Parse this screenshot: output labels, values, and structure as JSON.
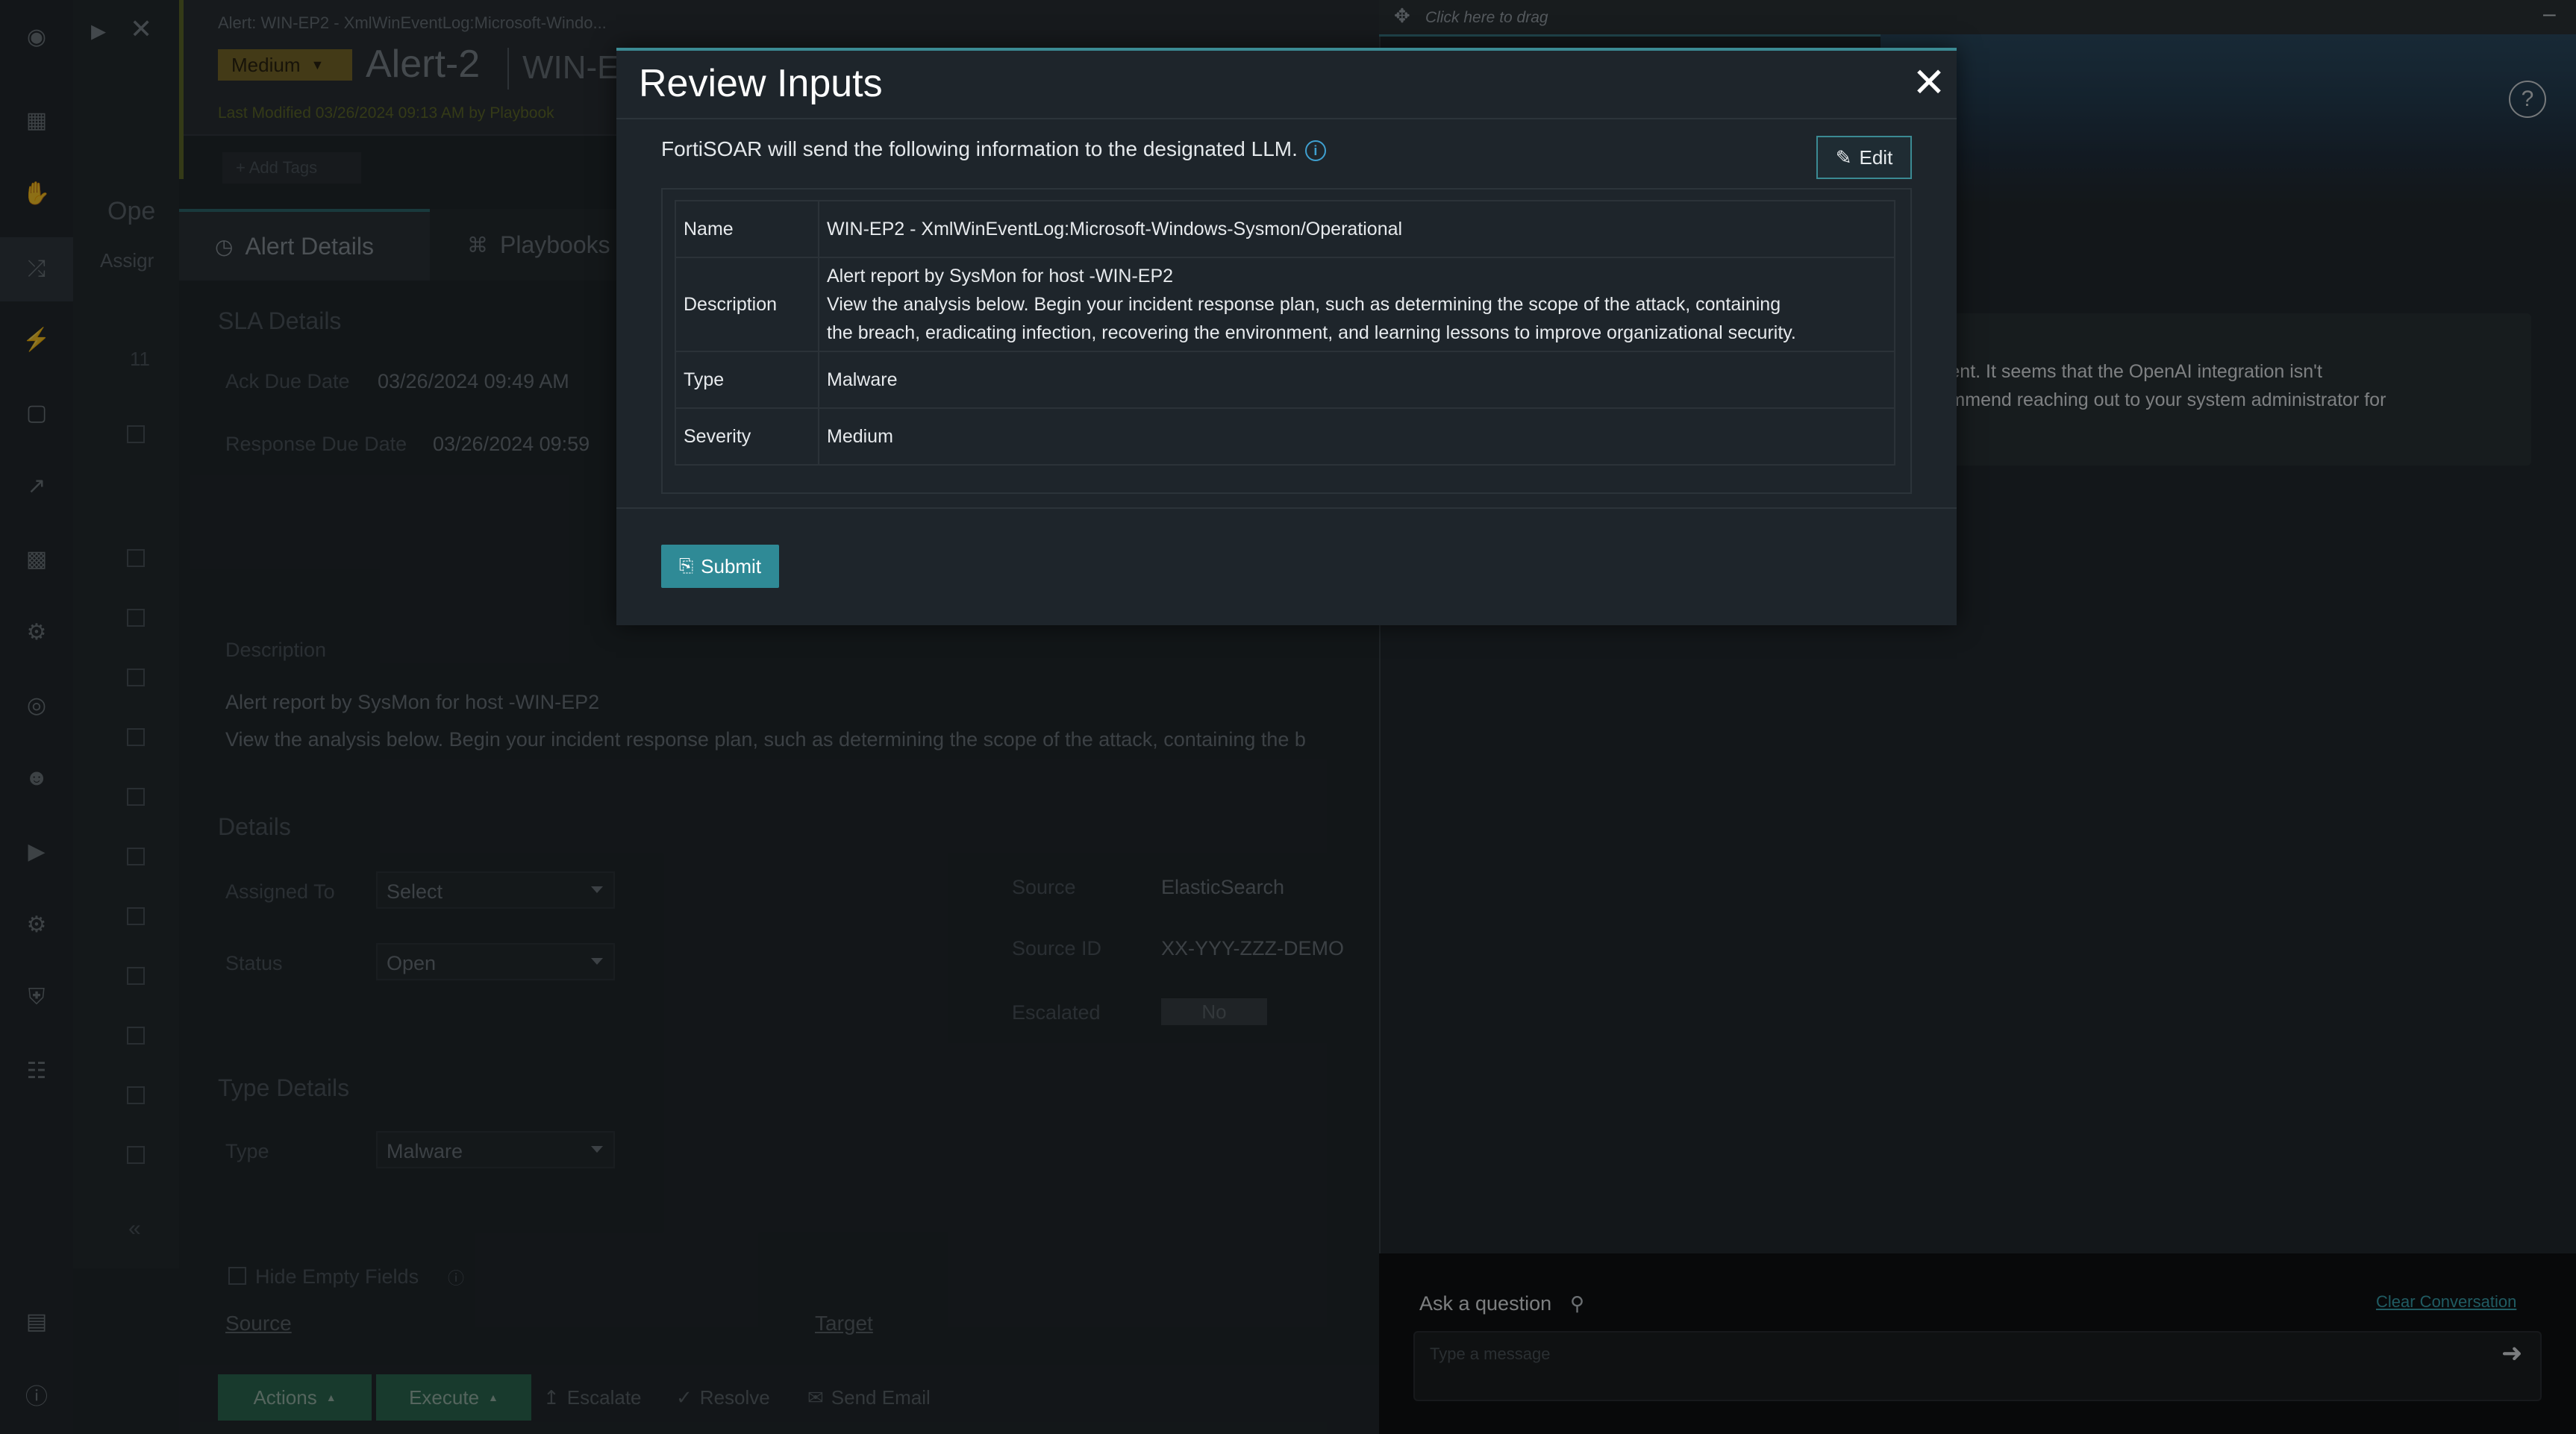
{
  "background": {
    "breadcrumb": "Alert: WIN-EP2 - XmlWinEventLog:Microsoft-Windo...",
    "severity_badge": "Medium",
    "alert_title": "Alert-2",
    "alert_subtitle": "WIN-E",
    "last_modified": "Last Modified 03/26/2024 09:13 AM by Playbook",
    "add_tags": "+ Add Tags",
    "side_status": "Ope",
    "side_assign": "Assigr",
    "side_count": "11",
    "tabs": [
      "Alert Details",
      "Playbooks"
    ],
    "sla_heading": "SLA Details",
    "ack_due_label": "Ack Due Date",
    "ack_due_value": "03/26/2024 09:49 AM",
    "response_due_label": "Response Due Date",
    "response_due_value": "03/26/2024 09:59",
    "description_label": "Description",
    "description_line1": "Alert report by SysMon for host -WIN-EP2",
    "description_line2": "View the analysis below. Begin your incident response plan, such as determining the scope of the attack, containing the b",
    "details_heading": "Details",
    "assigned_to_label": "Assigned To",
    "assigned_to_value": "Select",
    "status_label": "Status",
    "status_value": "Open",
    "source_label": "Source",
    "source_value": "ElasticSearch",
    "source_id_label": "Source ID",
    "source_id_value": "XX-YYY-ZZZ-DEMO",
    "escalated_label": "Escalated",
    "escalated_value": "No",
    "type_details_heading": "Type Details",
    "type_label": "Type",
    "type_value": "Malware",
    "hide_empty_fields": "Hide Empty Fields",
    "source_link": "Source",
    "target_link": "Target",
    "bottom_buttons": [
      "Actions",
      "Execute",
      "Escalate",
      "Resolve",
      "Send Email"
    ]
  },
  "chat": {
    "drag_hint": "Click here to drag",
    "message_line1": "e moment. It seems that the OpenAI integration isn't",
    "message_line2": "/e recommend reaching out to your system administrator for",
    "ask_label": "Ask a question",
    "clear_label": "Clear Conversation",
    "input_placeholder": "Type a message"
  },
  "modal": {
    "title": "Review Inputs",
    "intro": "FortiSOAR will send the following information to the designated LLM.",
    "edit_label": "Edit",
    "rows": [
      {
        "key": "Name",
        "value_lines": [
          "WIN-EP2 - XmlWinEventLog:Microsoft-Windows-Sysmon/Operational"
        ]
      },
      {
        "key": "Description",
        "value_lines": [
          "Alert report by SysMon for host -WIN-EP2",
          "View the analysis below. Begin your incident response plan, such as determining the scope of the attack, containing",
          "the breach, eradicating infection, recovering the environment, and learning lessons to improve organizational security."
        ]
      },
      {
        "key": "Type",
        "value_lines": [
          "Malware"
        ]
      },
      {
        "key": "Severity",
        "value_lines": [
          "Medium"
        ]
      }
    ],
    "submit_label": "Submit"
  }
}
